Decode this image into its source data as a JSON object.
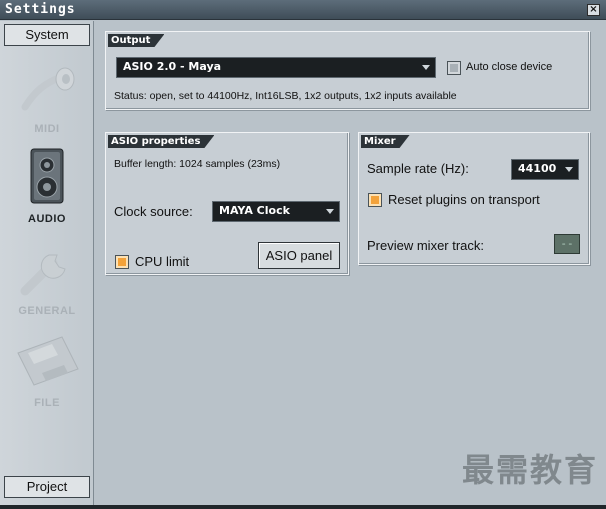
{
  "window": {
    "title": "Settings",
    "close_symbol": "×"
  },
  "sidebar": {
    "top_tab": "System",
    "bottom_tab": "Project",
    "items": [
      {
        "label": "MIDI",
        "icon": "midi-plug-icon",
        "active": false
      },
      {
        "label": "AUDIO",
        "icon": "speaker-icon",
        "active": true
      },
      {
        "label": "GENERAL",
        "icon": "wrench-icon",
        "active": false
      },
      {
        "label": "FILE",
        "icon": "floppy-disk-icon",
        "active": false
      }
    ]
  },
  "output": {
    "title": "Output",
    "device": "ASIO 2.0 - Maya",
    "auto_close_label": "Auto close device",
    "auto_close_checked": false,
    "status": "Status: open, set to 44100Hz, Int16LSB, 1x2 outputs, 1x2 inputs available"
  },
  "asio": {
    "title": "ASIO properties",
    "buffer_length": "Buffer length: 1024 samples (23ms)",
    "clock_source_label": "Clock source:",
    "clock_source_value": "MAYA Clock",
    "cpu_limit_label": "CPU limit",
    "cpu_limit_checked": true,
    "panel_button": "ASIO panel"
  },
  "mixer": {
    "title": "Mixer",
    "sample_rate_label": "Sample rate (Hz):",
    "sample_rate_value": "44100",
    "reset_plugins_label": "Reset plugins on transport",
    "reset_plugins_checked": true,
    "preview_track_label": "Preview mixer track:",
    "preview_track_value": "--"
  },
  "watermark": "最需教育",
  "colors": {
    "accent_checkbox": "#f3a23a",
    "title_bar": "#3f4d58",
    "panel_bg": "#c7ced4"
  }
}
